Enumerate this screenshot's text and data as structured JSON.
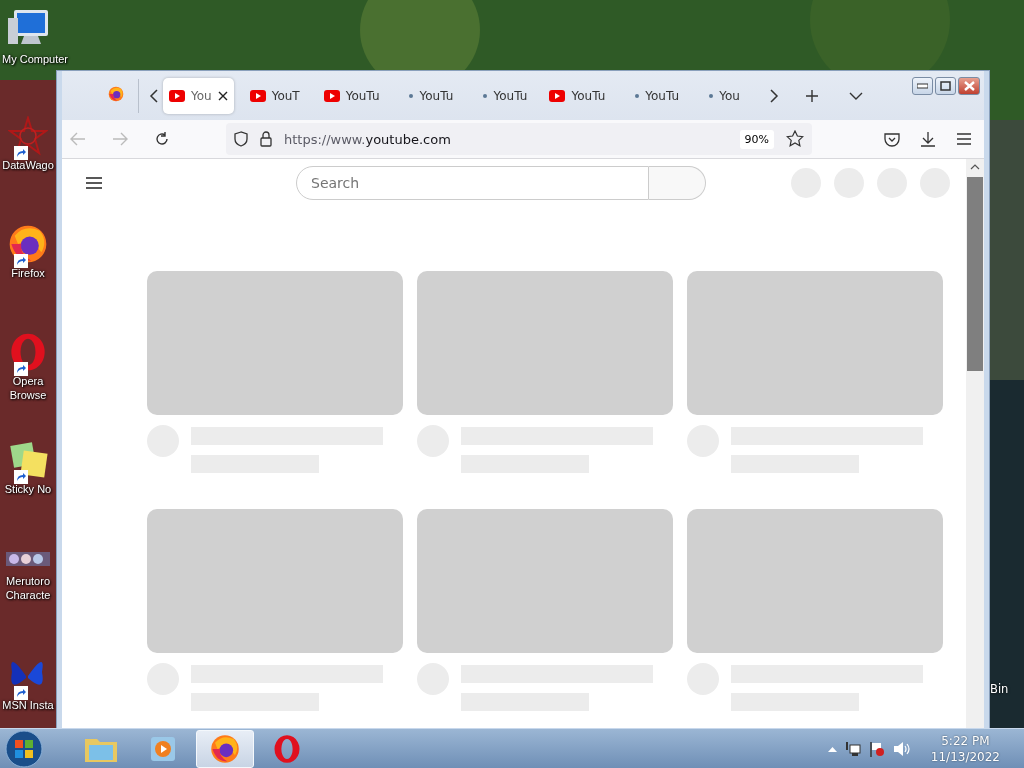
{
  "desktop_icons": [
    {
      "label": "My Computer",
      "kind": "computer",
      "shortcut": false
    },
    {
      "label": "DataWago",
      "kind": "star",
      "shortcut": true
    },
    {
      "label": "Firefox",
      "kind": "firefox",
      "shortcut": true
    },
    {
      "label": "Opera Browse",
      "kind": "opera",
      "shortcut": true
    },
    {
      "label": "Sticky No",
      "kind": "sticky",
      "shortcut": true
    },
    {
      "label": "Merutoro Characte",
      "kind": "strip",
      "shortcut": false
    },
    {
      "label": "MSN Insta",
      "kind": "butterfly",
      "shortcut": true
    }
  ],
  "desktop_right_icon": {
    "label": "Bin"
  },
  "window": {
    "tabs": [
      {
        "label": "You",
        "kind": "youtube",
        "selected": true
      },
      {
        "label": "YouT",
        "kind": "youtube",
        "selected": false
      },
      {
        "label": "YouTu",
        "kind": "youtube",
        "selected": false
      },
      {
        "label": "YouTu",
        "kind": "dot",
        "selected": false
      },
      {
        "label": "YouTu",
        "kind": "dot",
        "selected": false
      },
      {
        "label": "YouTu",
        "kind": "youtube",
        "selected": false
      },
      {
        "label": "YouTu",
        "kind": "dot",
        "selected": false
      },
      {
        "label": "You",
        "kind": "dot",
        "selected": false
      }
    ],
    "address": {
      "scheme": "https://www.",
      "host": "youtube.com"
    },
    "zoom": "90%",
    "page": {
      "search": {
        "placeholder": "Search"
      },
      "cards": [
        {
          "kind": "video"
        },
        {
          "kind": "video"
        },
        {
          "kind": "video"
        },
        {
          "kind": "video"
        },
        {
          "kind": "video"
        },
        {
          "kind": "video"
        }
      ]
    }
  },
  "taskbar": {
    "apps": [
      {
        "kind": "explorer",
        "selected": false
      },
      {
        "kind": "player",
        "selected": false
      },
      {
        "kind": "firefox",
        "selected": true
      },
      {
        "kind": "opera",
        "selected": false
      }
    ],
    "time": "5:22 PM",
    "date": "11/13/2022"
  }
}
